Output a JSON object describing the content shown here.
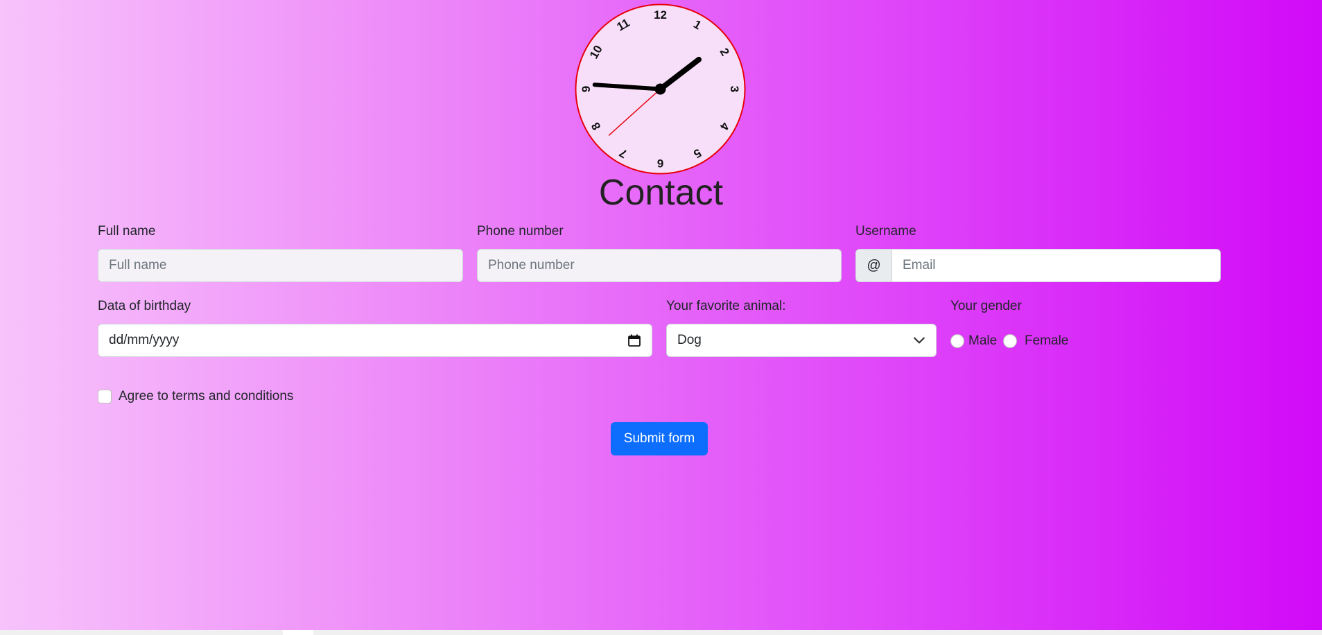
{
  "clock": {
    "numbers": [
      "12",
      "1",
      "2",
      "3",
      "4",
      "5",
      "6",
      "7",
      "8",
      "9",
      "10",
      "11"
    ],
    "time": {
      "hour": 1,
      "minute": 45,
      "second": 38
    },
    "face_color": "#f7dff9",
    "rim_color": "#e8000b",
    "hand_color": "#000000",
    "second_hand_color": "#e8000b"
  },
  "page": {
    "title": "Contact"
  },
  "form": {
    "full_name": {
      "label": "Full name",
      "placeholder": "Full name"
    },
    "phone": {
      "label": "Phone number",
      "placeholder": "Phone number"
    },
    "username": {
      "label": "Username",
      "prefix": "@",
      "placeholder": "Email"
    },
    "birthday": {
      "label": "Data of birthday",
      "value": "dd/mm/yyyy",
      "icon": "calendar-icon"
    },
    "animal": {
      "label": "Your favorite animal:",
      "selected": "Dog",
      "icon": "chevron-down-icon"
    },
    "gender": {
      "label": "Your gender",
      "options": [
        "Male",
        "Female"
      ]
    },
    "terms": {
      "label": "Agree to terms and conditions"
    },
    "submit_label": "Submit form"
  },
  "colors": {
    "accent": "#0d6efd",
    "gradient_start": "#f7c3fb",
    "gradient_end": "#d10af8"
  }
}
